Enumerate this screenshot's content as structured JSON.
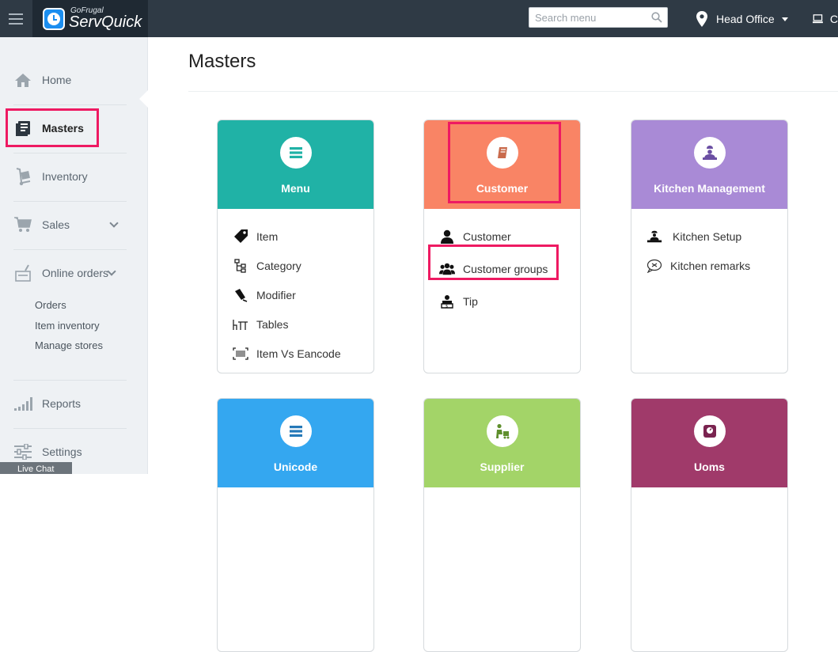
{
  "header": {
    "brand_small": "GoFrugal",
    "brand_big": "ServQuick",
    "search_placeholder": "Search menu",
    "location": "Head Office",
    "monitor_label": "C"
  },
  "sidebar": {
    "items": [
      {
        "label": "Home",
        "icon": "home-icon"
      },
      {
        "label": "Masters",
        "icon": "masters-icon",
        "active": true
      },
      {
        "label": "Inventory",
        "icon": "inventory-icon"
      },
      {
        "label": "Sales",
        "icon": "cart-icon",
        "expandable": true
      },
      {
        "label": "Online orders",
        "icon": "online-orders-icon",
        "expandable": true
      },
      {
        "label": "Reports",
        "icon": "reports-icon"
      },
      {
        "label": "Settings",
        "icon": "settings-icon"
      }
    ],
    "online_sub": [
      "Orders",
      "Item inventory",
      "Manage stores"
    ],
    "chat_label": "Live Chat"
  },
  "main": {
    "title": "Masters",
    "cards": [
      {
        "title": "Menu",
        "color": "#20b2a6",
        "icon": "menu-list-icon",
        "items": [
          {
            "label": "Item",
            "icon": "tag-icon"
          },
          {
            "label": "Category",
            "icon": "category-tree-icon"
          },
          {
            "label": "Modifier",
            "icon": "modifier-icon"
          },
          {
            "label": "Tables",
            "icon": "table-icon"
          },
          {
            "label": "Item Vs Eancode",
            "icon": "barcode-icon"
          }
        ]
      },
      {
        "title": "Customer",
        "color": "#f98465",
        "icon": "book-icon",
        "items": [
          {
            "label": "Customer",
            "icon": "user-icon"
          },
          {
            "label": "Customer groups",
            "icon": "users-group-icon"
          },
          {
            "label": "Tip",
            "icon": "tip-icon"
          }
        ]
      },
      {
        "title": "Kitchen Management",
        "color": "#a98ad6",
        "icon": "chef-icon",
        "items": [
          {
            "label": "Kitchen Setup",
            "icon": "kitchen-setup-icon"
          },
          {
            "label": "Kitchen remarks",
            "icon": "remarks-icon"
          }
        ]
      },
      {
        "title": "Unicode",
        "color": "#34a7f0",
        "icon": "unicode-list-icon",
        "items": []
      },
      {
        "title": "Supplier",
        "color": "#a3d468",
        "icon": "supplier-icon",
        "items": []
      },
      {
        "title": "Uoms",
        "color": "#a03a6a",
        "icon": "scale-icon",
        "items": []
      }
    ]
  },
  "highlight_color": "#ee1a62"
}
